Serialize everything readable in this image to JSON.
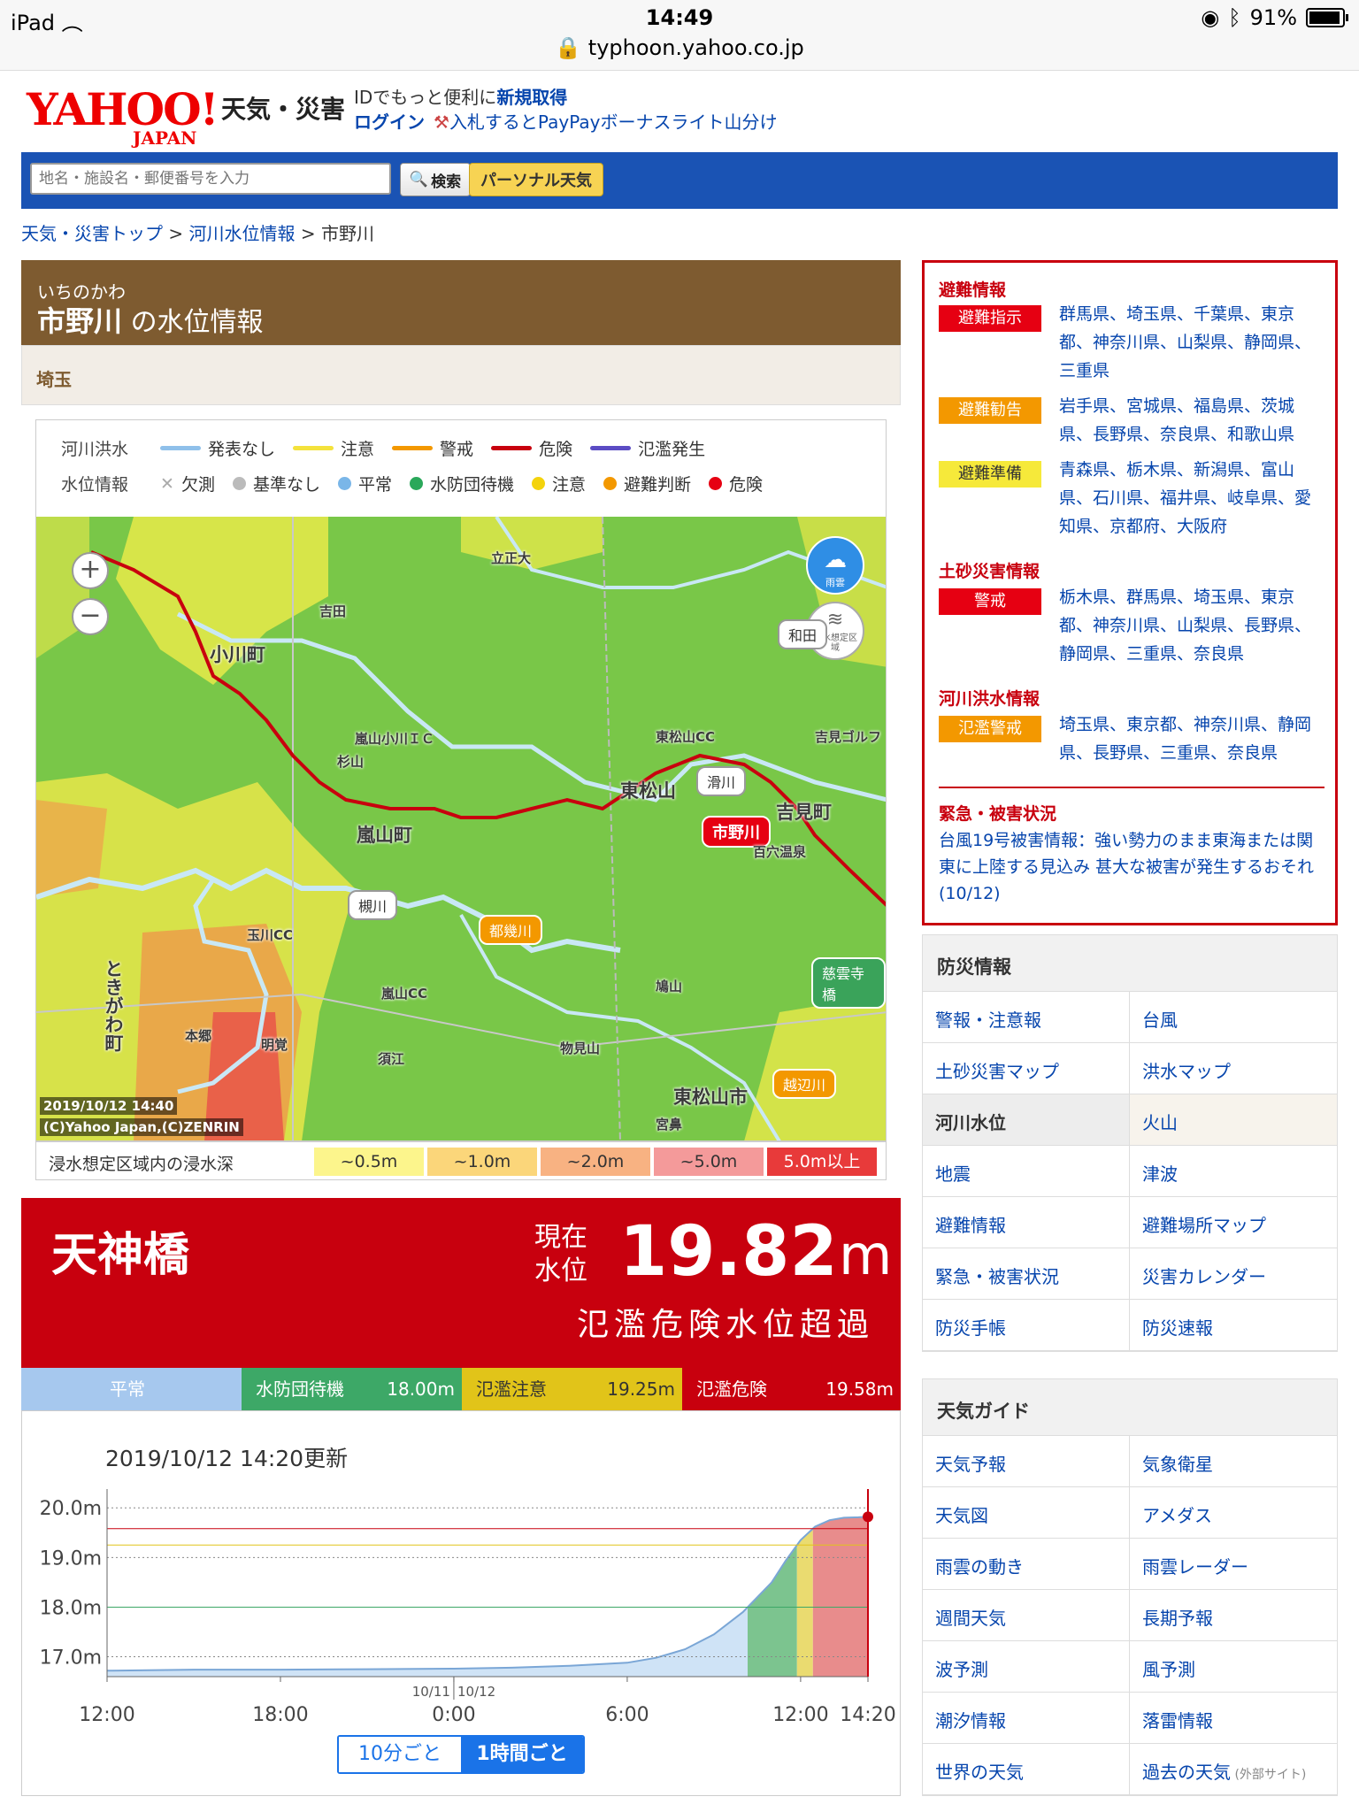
{
  "status_bar": {
    "device": "iPad",
    "time": "14:49",
    "url": "typhoon.yahoo.co.jp",
    "battery": "91%"
  },
  "header": {
    "logo": "YAHOO!",
    "logo_sub": "JAPAN",
    "site": "天気・災害",
    "promo_text": "IDでもっと便利に",
    "signup": "新規取得",
    "login": "ログイン",
    "promo2": "入札するとPayPayボーナスライト山分け"
  },
  "search": {
    "placeholder": "地名・施設名・郵便番号を入力",
    "button": "検索",
    "personal": "パーソナル天気"
  },
  "breadcrumb": {
    "top": "天気・災害トップ",
    "sep": ">",
    "mid": "河川水位情報",
    "current": "市野川"
  },
  "river": {
    "kana": "いちのかわ",
    "name": "市野川",
    "suffix": "の水位情報",
    "prefecture": "埼玉"
  },
  "legend": {
    "flood_title": "河川洪水",
    "flood_items": [
      {
        "label": "発表なし",
        "color": "#8fc0ea"
      },
      {
        "label": "注意",
        "color": "#f4e23c"
      },
      {
        "label": "警戒",
        "color": "#f39800"
      },
      {
        "label": "危険",
        "color": "#c8000e"
      },
      {
        "label": "氾濫発生",
        "color": "#5b4cc4"
      }
    ],
    "level_title": "水位情報",
    "level_items": [
      {
        "label": "欠測",
        "color": "#bbbbbb",
        "icon": "cross-icon"
      },
      {
        "label": "基準なし",
        "color": "#bbbbbb"
      },
      {
        "label": "平常",
        "color": "#7ab6e8"
      },
      {
        "label": "水防団待機",
        "color": "#2aa85a"
      },
      {
        "label": "注意",
        "color": "#f4d30c"
      },
      {
        "label": "避難判断",
        "color": "#f39800"
      },
      {
        "label": "危険",
        "color": "#e60012"
      }
    ]
  },
  "map": {
    "labels": {
      "ichinokawa": "市野川",
      "tsukigawa": "槻川",
      "tokigawa": "都幾川",
      "namegawa": "滑川",
      "koshibegawa": "越辺川",
      "jiunjibashi": "慈雲寺橋",
      "wada": "和田"
    },
    "places": {
      "ogawamachi": "小川町",
      "ranzan": "嵐山町",
      "higashimatsuyama": "東松山",
      "yoshimi": "吉見町",
      "tokigawamachi": "ときがわ町",
      "higashimatsuyama2": "東松山市",
      "hatoyama": "鳩山",
      "risshodai": "立正大",
      "yoshida": "吉田",
      "higashimatsuyama_cc": "東松山CC",
      "hyakuana": "百穴温泉",
      "yoshimi_golf": "吉見ゴルフ",
      "ranzan_ic": "嵐山小川ＩＣ",
      "sugiyama": "杉山",
      "ranzan_cc": "嵐山CC",
      "tamagawa_cc": "玉川CC",
      "hongo": "本郷",
      "meikaku": "明覚",
      "sue": "須江",
      "monomiyama": "物見山",
      "miyahata": "宮鼻"
    },
    "controls": {
      "rain": "雨雲",
      "flood_area": "浸水想定区域"
    },
    "timestamp": "2019/10/12 14:40",
    "copyright": "(C)Yahoo Japan,(C)ZENRIN"
  },
  "depth_legend": {
    "label": "浸水想定区域内の浸水深",
    "items": [
      {
        "label": "~0.5m",
        "color": "#fcf58c"
      },
      {
        "label": "~1.0m",
        "color": "#fbd67a"
      },
      {
        "label": "~2.0m",
        "color": "#f8b282"
      },
      {
        "label": "~5.0m",
        "color": "#f49a9a"
      },
      {
        "label": "5.0m以上",
        "color": "#e83a3a"
      }
    ]
  },
  "level": {
    "station": "天神橋",
    "current_label": "現在水位",
    "current_label_1": "現在",
    "current_label_2": "水位",
    "value": "19.82",
    "unit": "m",
    "status": "氾濫危険水位超過"
  },
  "thresholds": [
    {
      "name": "平常",
      "value": "",
      "color": "#a6c8ee",
      "text": "#fff"
    },
    {
      "name": "水防団待機",
      "value": "18.00m",
      "color": "#3da867",
      "text": "#fff"
    },
    {
      "name": "氾濫注意",
      "value": "19.25m",
      "color": "#e1c419",
      "text": "#333"
    },
    {
      "name": "氾濫危険",
      "value": "19.58m",
      "color": "#c8000e",
      "text": "#fff"
    }
  ],
  "chart_data": {
    "type": "area",
    "title": "",
    "updated": "2019/10/12 14:20更新",
    "x_ticks": [
      "12:00",
      "18:00",
      "0:00",
      "6:00",
      "12:00",
      "14:20"
    ],
    "date_marks": [
      "10/11",
      "10/12"
    ],
    "y_ticks": [
      "20.0m",
      "19.0m",
      "18.0m",
      "17.0m"
    ],
    "ylim": [
      16.6,
      20.2
    ],
    "xlim_hours": [
      -12,
      14.33
    ],
    "series": [
      {
        "values_x_hours": [
          -12,
          -9,
          -6,
          -3,
          0,
          2,
          4,
          6,
          7,
          8,
          9,
          10,
          11,
          11.5,
          12,
          12.5,
          13,
          13.5,
          14,
          14.33
        ],
        "values": [
          16.72,
          16.74,
          16.74,
          16.75,
          16.76,
          16.78,
          16.82,
          16.88,
          16.98,
          17.15,
          17.45,
          17.9,
          18.5,
          18.95,
          19.35,
          19.62,
          19.75,
          19.8,
          19.81,
          19.82
        ]
      }
    ],
    "thresholds": [
      18.0,
      19.25,
      19.58
    ],
    "current": {
      "x_hours": 14.33,
      "value": 19.82
    }
  },
  "interval_toggle": {
    "ten_min": "10分ごと",
    "hourly": "1時間ごと"
  },
  "alerts": {
    "evac_title": "避難情報",
    "evac_order": {
      "label": "避難指示",
      "prefs": "群馬県、埼玉県、千葉県、東京都、神奈川県、山梨県、静岡県、三重県"
    },
    "evac_advisory": {
      "label": "避難勧告",
      "prefs": "岩手県、宮城県、福島県、茨城県、長野県、奈良県、和歌山県"
    },
    "evac_prep": {
      "label": "避難準備",
      "prefs": "青森県、栃木県、新潟県、富山県、石川県、福井県、岐阜県、愛知県、京都府、大阪府"
    },
    "landslide_title": "土砂災害情報",
    "landslide": {
      "label": "警戒",
      "prefs": "栃木県、群馬県、埼玉県、東京都、神奈川県、山梨県、長野県、静岡県、三重県、奈良県"
    },
    "flood_title": "河川洪水情報",
    "flood": {
      "label": "氾濫警戒",
      "prefs": "埼玉県、東京都、神奈川県、静岡県、長野県、三重県、奈良県"
    },
    "emergency_title": "緊急・被害状況",
    "emergency_text": "台風19号被害情報：強い勢力のまま東海または関東に上陸する見込み 甚大な被害が発生するおそれ(10/12)"
  },
  "disaster_links": {
    "title": "防災情報",
    "items": [
      "警報・注意報",
      "台風",
      "土砂災害マップ",
      "洪水マップ",
      "河川水位",
      "火山",
      "地震",
      "津波",
      "避難情報",
      "避難場所マップ",
      "緊急・被害状況",
      "災害カレンダー",
      "防災手帳",
      "防災速報"
    ]
  },
  "weather_links": {
    "title": "天気ガイド",
    "items": [
      "天気予報",
      "気象衛星",
      "天気図",
      "アメダス",
      "雨雲の動き",
      "雨雲レーダー",
      "週間天気",
      "長期予報",
      "波予測",
      "風予測",
      "潮汐情報",
      "落雷情報",
      "世界の天気",
      "過去の天気"
    ],
    "ext_note": "(外部サイト)"
  }
}
